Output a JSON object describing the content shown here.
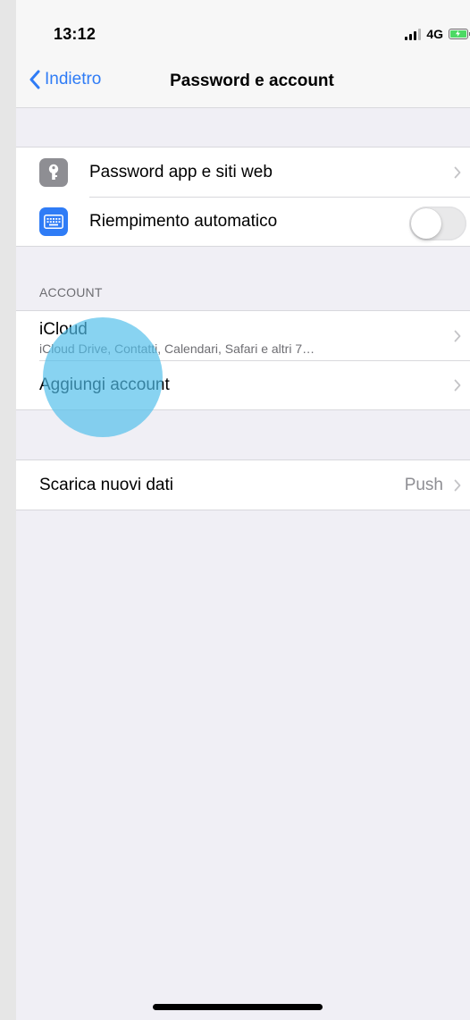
{
  "status_bar": {
    "time": "13:12",
    "network": "4G"
  },
  "nav": {
    "back_label": "Indietro",
    "title": "Password e account"
  },
  "group1": {
    "passwords_label": "Password app e siti web",
    "autofill_label": "Riempimento automatico",
    "autofill_enabled": false
  },
  "accounts": {
    "header": "ACCOUNT",
    "icloud_title": "iCloud",
    "icloud_subtitle": "iCloud Drive, Contatti, Calendari, Safari e altri 7…",
    "add_account_label": "Aggiungi account"
  },
  "fetch": {
    "label": "Scarica nuovi dati",
    "value": "Push"
  },
  "colors": {
    "accent": "#2f7cf6",
    "touch_indicator": "#50beeb"
  },
  "icons": {
    "back": "chevron-left-icon",
    "row_chevron": "chevron-right-icon",
    "key": "key-icon",
    "keyboard": "keyboard-icon"
  }
}
